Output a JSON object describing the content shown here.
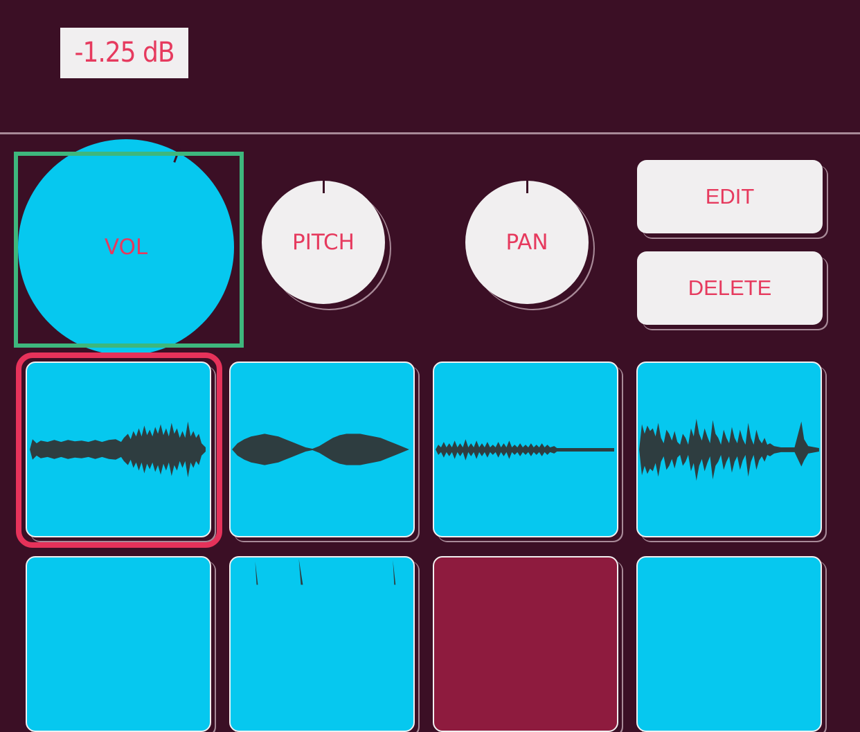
{
  "readout": {
    "value": "-1.25 dB"
  },
  "knobs": {
    "vol": {
      "label": "VOL",
      "level": 0.62
    },
    "pitch": {
      "label": "PITCH",
      "level": 0.5
    },
    "pan": {
      "label": "PAN",
      "level": 0.5
    }
  },
  "buttons": {
    "edit": "EDIT",
    "delete": "DELETE"
  },
  "colors": {
    "background": "#3b0f25",
    "accent": "#e63a5e",
    "pad": "#06c8ef",
    "knob": "#f1eff0",
    "focus_frame": "#3eb77d",
    "waveform": "#2e3d40"
  },
  "pads": [
    {
      "waveform": "pad-1-wave",
      "selected": true
    },
    {
      "waveform": "pad-2-wave",
      "selected": false
    },
    {
      "waveform": "pad-3-wave",
      "selected": false
    },
    {
      "waveform": "pad-4-wave",
      "selected": false
    },
    {
      "waveform": "pad-5-wave",
      "selected": false
    },
    {
      "waveform": "pad-6-wave",
      "selected": false
    },
    {
      "waveform": "pad-7-wave",
      "selected": false
    },
    {
      "waveform": "pad-8-wave",
      "selected": false
    }
  ]
}
